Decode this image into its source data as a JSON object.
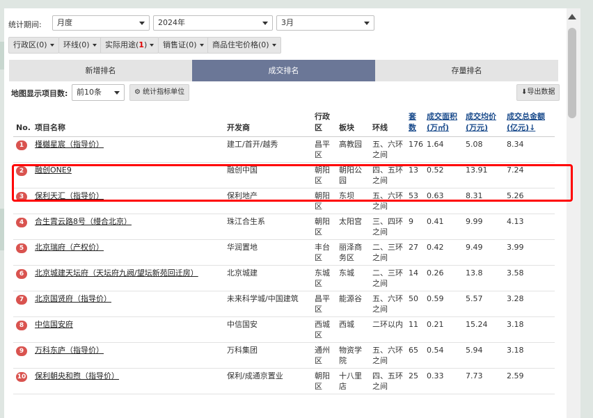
{
  "filters": {
    "label": "统计期间:",
    "period_type": "月度",
    "year": "2024年",
    "month": "3月"
  },
  "chips": [
    {
      "label": "行政区(",
      "count": "0",
      "suffix": ")"
    },
    {
      "label": "环线(",
      "count": "0",
      "suffix": ")"
    },
    {
      "label": "实际用途(",
      "count": "1",
      "suffix": ")"
    },
    {
      "label": "销售证(",
      "count": "0",
      "suffix": ")"
    },
    {
      "label": "商品住宅价格(",
      "count": "0",
      "suffix": ")"
    }
  ],
  "tabs": [
    {
      "label": "新增排名",
      "active": false
    },
    {
      "label": "成交排名",
      "active": true
    },
    {
      "label": "存量排名",
      "active": false
    }
  ],
  "toolbar": {
    "map_count_label": "地图显示项目数:",
    "map_count_value": "前10条",
    "unit_button": "统计指标单位",
    "export_button": "导出数据"
  },
  "table": {
    "headers": {
      "no": "No.",
      "name": "项目名称",
      "developer": "开发商",
      "district": "行政区",
      "block": "板块",
      "ring": "环线",
      "units": "套数",
      "area": "成交面积(万㎡)",
      "price": "成交均价(万元)",
      "total": "成交总金额(亿元)"
    },
    "rows": [
      {
        "no": "1",
        "name": "槿樾星宸（指导价）",
        "developer": "建工/首开/越秀",
        "district": "昌平区",
        "block": "高教园",
        "ring": "五、六环之间",
        "units": "176",
        "area": "1.64",
        "price": "5.08",
        "total": "8.34"
      },
      {
        "no": "2",
        "name": "融创ONE9",
        "developer": "融创中国",
        "district": "朝阳区",
        "block": "朝阳公园",
        "ring": "四、五环之间",
        "units": "13",
        "area": "0.52",
        "price": "13.91",
        "total": "7.24"
      },
      {
        "no": "3",
        "name": "保利天汇（指导价）",
        "developer": "保利地产",
        "district": "朝阳区",
        "block": "东坝",
        "ring": "五、六环之间",
        "units": "53",
        "area": "0.63",
        "price": "8.31",
        "total": "5.26"
      },
      {
        "no": "4",
        "name": "合生霄云路8号（缦合北京）",
        "developer": "珠江合生系",
        "district": "朝阳区",
        "block": "太阳宫",
        "ring": "三、四环之间",
        "units": "9",
        "area": "0.41",
        "price": "9.99",
        "total": "4.13"
      },
      {
        "no": "5",
        "name": "北京瑞府（产权价）",
        "developer": "华润置地",
        "district": "丰台区",
        "block": "丽泽商务区",
        "ring": "二、三环之间",
        "units": "27",
        "area": "0.42",
        "price": "9.49",
        "total": "3.99"
      },
      {
        "no": "6",
        "name": "北京城建天坛府（天坛府九阙/望坛新苑回迁房）",
        "developer": "北京城建",
        "district": "东城区",
        "block": "东城",
        "ring": "二、三环之间",
        "units": "14",
        "area": "0.26",
        "price": "13.8",
        "total": "3.58"
      },
      {
        "no": "7",
        "name": "北京国贤府（指导价）",
        "developer": "未来科学城/中国建筑",
        "district": "昌平区",
        "block": "能源谷",
        "ring": "五、六环之间",
        "units": "50",
        "area": "0.59",
        "price": "5.57",
        "total": "3.28"
      },
      {
        "no": "8",
        "name": "中信国安府",
        "developer": "中信国安",
        "district": "西城区",
        "block": "西城",
        "ring": "二环以内",
        "units": "11",
        "area": "0.21",
        "price": "15.24",
        "total": "3.18"
      },
      {
        "no": "9",
        "name": "万科东庐（指导价）",
        "developer": "万科集团",
        "district": "通州区",
        "block": "物资学院",
        "ring": "五、六环之间",
        "units": "65",
        "area": "0.54",
        "price": "5.94",
        "total": "3.18"
      },
      {
        "no": "10",
        "name": "保利朝央和煦（指导价）",
        "developer": "保利/成通京置业",
        "district": "朝阳区",
        "block": "十八里店",
        "ring": "四、五环之间",
        "units": "25",
        "area": "0.33",
        "price": "7.73",
        "total": "2.59"
      }
    ]
  },
  "colors": {
    "active_tab": "#6b7797",
    "rank_badge": "#d9534f",
    "highlight": "#ff0000"
  }
}
